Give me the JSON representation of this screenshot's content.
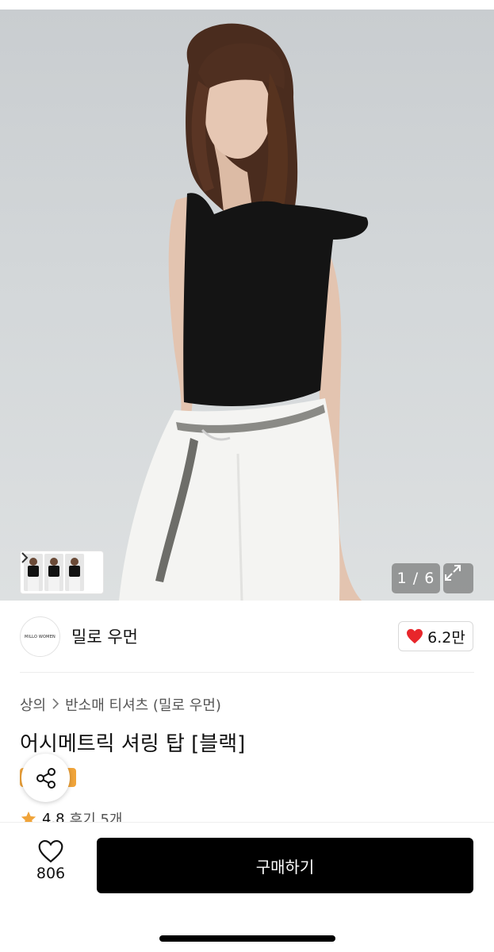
{
  "hero": {
    "image_counter": "1 / 6",
    "expand_icon": "expand-arrows-icon",
    "thumbnail_chevron_icon": "chevron-right-icon"
  },
  "brand": {
    "logo_text": "MILLO WOMEN",
    "name": "밀로 우먼",
    "like_count": "6.2만",
    "like_icon": "heart-filled-icon",
    "like_color": "#e8262b"
  },
  "product": {
    "breadcrumb": [
      "상의",
      "반소매 티셔츠 (밀로 우먼)"
    ],
    "title": "어시메트릭 셔링 탑 [블랙]",
    "rating": "4.8",
    "review_label": "후기 5개",
    "star_color": "#f0a43a",
    "share_icon": "share-icon"
  },
  "bottom": {
    "wish_count": "806",
    "wish_icon": "heart-outline-icon",
    "buy_label": "구매하기",
    "buy_color": "#000000"
  }
}
